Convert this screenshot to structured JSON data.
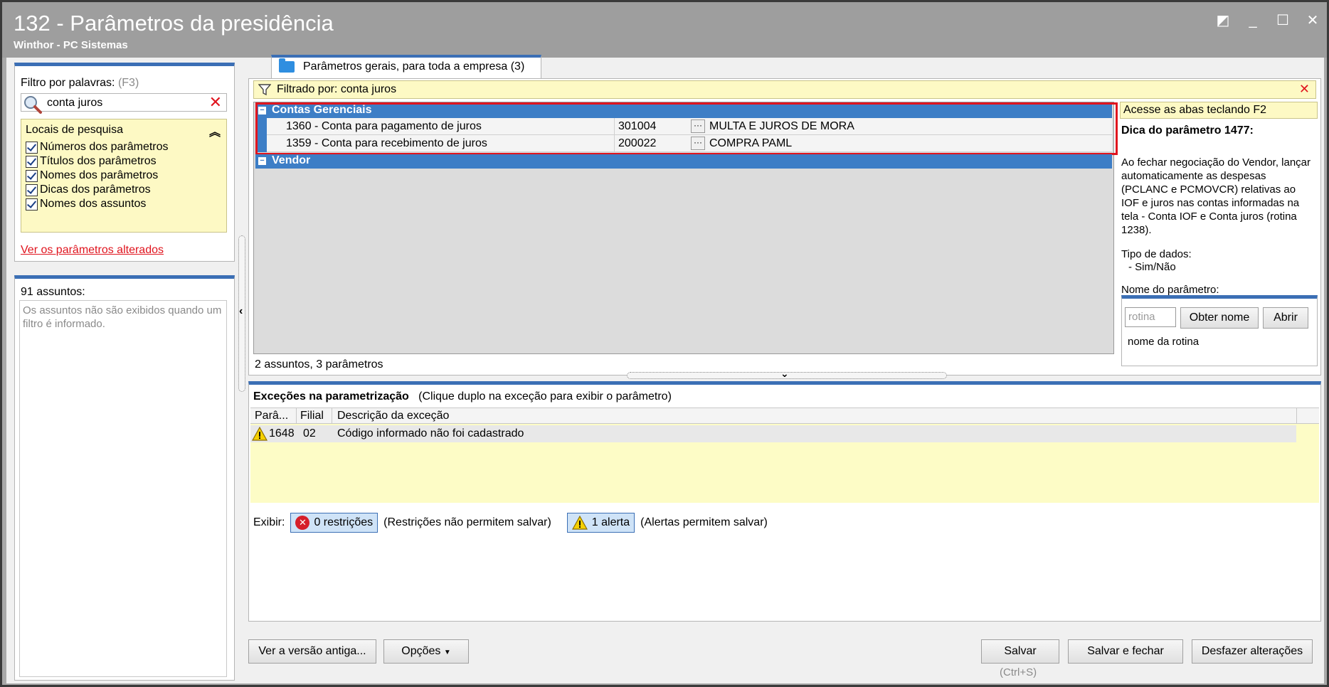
{
  "window": {
    "title": "132 - Parâmetros da presidência",
    "subtitle": "Winthor - PC Sistemas"
  },
  "filter": {
    "label": "Filtro por palavras:",
    "shortcut": "(F3)",
    "value": "conta juros",
    "locais_title": "Locais de pesquisa",
    "options": [
      "Números dos parâmetros",
      "Títulos dos parâmetros",
      "Nomes dos parâmetros",
      "Dicas dos parâmetros",
      "Nomes dos assuntos"
    ],
    "changed_link": "Ver os parâmetros alterados"
  },
  "assuntos": {
    "count": "91 assuntos:",
    "message": "Os assuntos não são exibidos quando um filtro é informado."
  },
  "tab": {
    "label": "Parâmetros gerais, para toda a empresa",
    "count": "(3)"
  },
  "filtered": {
    "text": "Filtrado por: conta juros"
  },
  "groups": [
    {
      "name": "Contas Gerenciais",
      "rows": [
        {
          "name": "1360 - Conta para pagamento de juros",
          "value": "301004",
          "desc": "MULTA E JUROS DE MORA"
        },
        {
          "name": "1359 - Conta para recebimento de juros",
          "value": "200022",
          "desc": "COMPRA PAML"
        }
      ]
    },
    {
      "name": "Vendor",
      "rows": []
    }
  ],
  "summary": "2 assuntos, 3 parâmetros",
  "help": {
    "f2_hint": "Acesse as abas teclando F2",
    "dica_title": "Dica do parâmetro 1477:",
    "dica_text": "Ao fechar negociação do Vendor, lançar automaticamente as despesas (PCLANC e PCMOVCR) relativas ao IOF e juros nas contas informadas na tela - Conta IOF e Conta juros (rotina 1238).",
    "tipo_label": "Tipo de dados:",
    "tipo_value": "- Sim/Não",
    "nome_label": "Nome do parâmetro:",
    "rotina_placeholder": "rotina",
    "obter_button": "Obter nome",
    "abrir_button": "Abrir",
    "rotina_caption": "nome da rotina"
  },
  "exceptions": {
    "title": "Exceções na parametrização",
    "hint": "(Clique duplo na exceção para exibir o parâmetro)",
    "columns": [
      "Parâ...",
      "Filial",
      "Descrição da exceção"
    ],
    "rows": [
      {
        "param": "1648",
        "filial": "02",
        "desc": "Código informado não foi cadastrado"
      }
    ],
    "exibir_label": "Exibir:",
    "restricoes": "0 restrições",
    "restricoes_note": "(Restrições não permitem salvar)",
    "alertas": "1 alerta",
    "alertas_note": "(Alertas permitem salvar)"
  },
  "buttons": {
    "old_version": "Ver a versão antiga...",
    "options": "Opções",
    "save": "Salvar",
    "save_shortcut": "(Ctrl+S)",
    "save_close": "Salvar e fechar",
    "undo": "Desfazer alterações"
  }
}
